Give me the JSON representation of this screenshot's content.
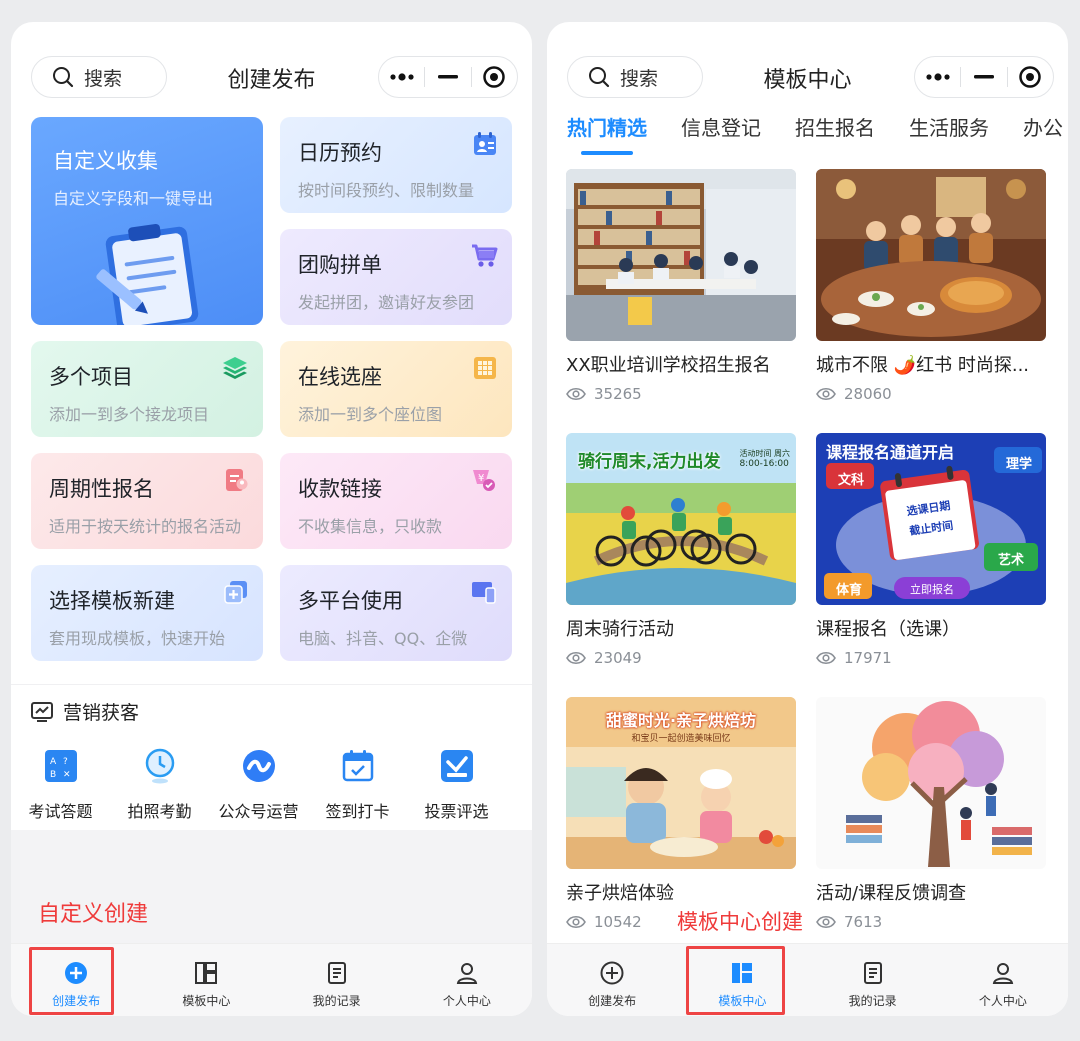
{
  "left": {
    "search_label": "搜索",
    "title": "创建发布",
    "cards": [
      {
        "title": "自定义收集",
        "subtitle": "自定义字段和一键导出"
      },
      {
        "title": "日历预约",
        "subtitle": "按时间段预约、限制数量"
      },
      {
        "title": "团购拼单",
        "subtitle": "发起拼团，邀请好友参团"
      },
      {
        "title": "多个项目",
        "subtitle": "添加一到多个接龙项目"
      },
      {
        "title": "在线选座",
        "subtitle": "添加一到多个座位图"
      },
      {
        "title": "周期性报名",
        "subtitle": "适用于按天统计的报名活动"
      },
      {
        "title": "收款链接",
        "subtitle": "不收集信息，只收款"
      },
      {
        "title": "选择模板新建",
        "subtitle": "套用现成模板，快速开始"
      },
      {
        "title": "多平台使用",
        "subtitle": "电脑、抖音、QQ、企微"
      }
    ],
    "marketing": {
      "title": "营销获客",
      "items": [
        "考试答题",
        "拍照考勤",
        "公众号运营",
        "签到打卡",
        "投票评选"
      ]
    },
    "annotation": "自定义创建"
  },
  "right": {
    "search_label": "搜索",
    "title": "模板中心",
    "categories": [
      "热门精选",
      "信息登记",
      "招生报名",
      "生活服务",
      "办公"
    ],
    "templates": [
      {
        "name": "XX职业培训学校招生报名",
        "views": "35265"
      },
      {
        "name": "城市不限 🌶️红书 时尚探...",
        "views": "28060"
      },
      {
        "name": "周末骑行活动",
        "views": "23049"
      },
      {
        "name": "课程报名（选课）",
        "views": "17971"
      },
      {
        "name": "亲子烘焙体验",
        "views": "10542"
      },
      {
        "name": "活动/课程反馈调查",
        "views": "7613"
      }
    ],
    "thumb_text": {
      "bike_title": "骑行周末,活力出发",
      "bike_time": "活动时间 周六",
      "bike_hours": "8:00-16:00",
      "course_title": "课程报名通道开启",
      "tag_wenke": "文科",
      "tag_like": "理学",
      "tag_tiyu": "体育",
      "tag_yishu": "艺术",
      "cal_line1": "选课日期",
      "cal_line2": "截止时间",
      "course_btn": "立即报名",
      "bake_title": "甜蜜时光·亲子烘焙坊",
      "bake_sub": "和宝贝一起创造美味回忆"
    },
    "annotation": "模板中心创建"
  },
  "tabbar": [
    "创建发布",
    "模板中心",
    "我的记录",
    "个人中心"
  ],
  "colors": {
    "accent": "#1d8cff",
    "annotation_red": "#ef3a3a"
  }
}
